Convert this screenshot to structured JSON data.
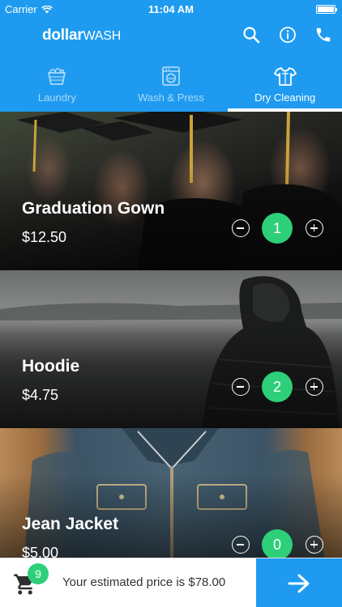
{
  "status_bar": {
    "carrier": "Carrier",
    "time": "11:04 AM"
  },
  "app": {
    "logo_bold": "dollar",
    "logo_light": "WASH"
  },
  "header_icons": [
    "search-icon",
    "info-icon",
    "phone-icon"
  ],
  "tabs": [
    {
      "label": "Laundry",
      "icon": "laundry-basket-icon",
      "active": false
    },
    {
      "label": "Wash & Press",
      "icon": "washing-machine-icon",
      "active": false
    },
    {
      "label": "Dry Cleaning",
      "icon": "shirt-icon",
      "active": true
    }
  ],
  "items": [
    {
      "name": "Graduation Gown",
      "price": "$12.50",
      "count": "1"
    },
    {
      "name": "Hoodie",
      "price": "$4.75",
      "count": "2"
    },
    {
      "name": "Jean Jacket",
      "price": "$5.00",
      "count": "0"
    }
  ],
  "cart": {
    "count": "9",
    "estimate": "Your estimated price is $78.00"
  },
  "colors": {
    "primary": "#1e9bf0",
    "accent_green": "#2dcf79"
  }
}
